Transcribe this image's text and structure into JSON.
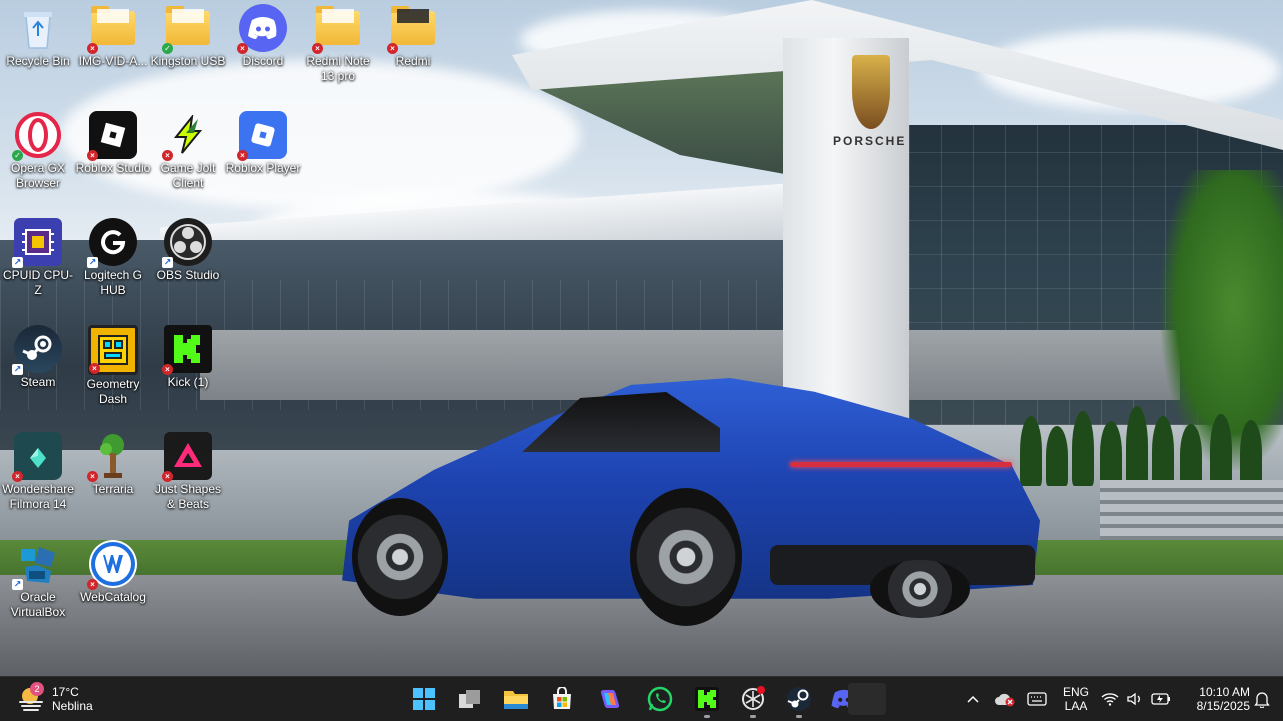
{
  "desktop": {
    "icons": [
      {
        "label": "Recycle Bin"
      },
      {
        "label": "IMG-VID-A..."
      },
      {
        "label": "Kingston USB"
      },
      {
        "label": "Discord"
      },
      {
        "label": "Redmi Note 13 pro"
      },
      {
        "label": "Redmi"
      },
      {
        "label": "Opera GX Browser"
      },
      {
        "label": "Roblox Studio"
      },
      {
        "label": "Game Jolt Client"
      },
      {
        "label": "Roblox Player"
      },
      {
        "label": "CPUID CPU-Z"
      },
      {
        "label": "Logitech G HUB"
      },
      {
        "label": "OBS Studio"
      },
      {
        "label": "Steam"
      },
      {
        "label": "Geometry Dash"
      },
      {
        "label": "Kick (1)"
      },
      {
        "label": "Wondershare Filmora 14"
      },
      {
        "label": "Terraria"
      },
      {
        "label": "Just Shapes & Beats"
      },
      {
        "label": "Oracle VirtualBox"
      },
      {
        "label": "WebCatalog"
      }
    ],
    "wallpaper_sign": "PORSCHE"
  },
  "taskbar": {
    "weather": {
      "temp": "17°C",
      "condition": "Neblina",
      "badge": "2"
    },
    "tray": {
      "language": "ENG",
      "layout": "LAA",
      "time": "10:10 AM",
      "date": "8/15/2025"
    }
  },
  "colors": {
    "taskbar_bg": "#1f1f1f",
    "error_badge": "#d1262b",
    "synced_badge": "#2aa84a",
    "accent": "#0078d4"
  }
}
